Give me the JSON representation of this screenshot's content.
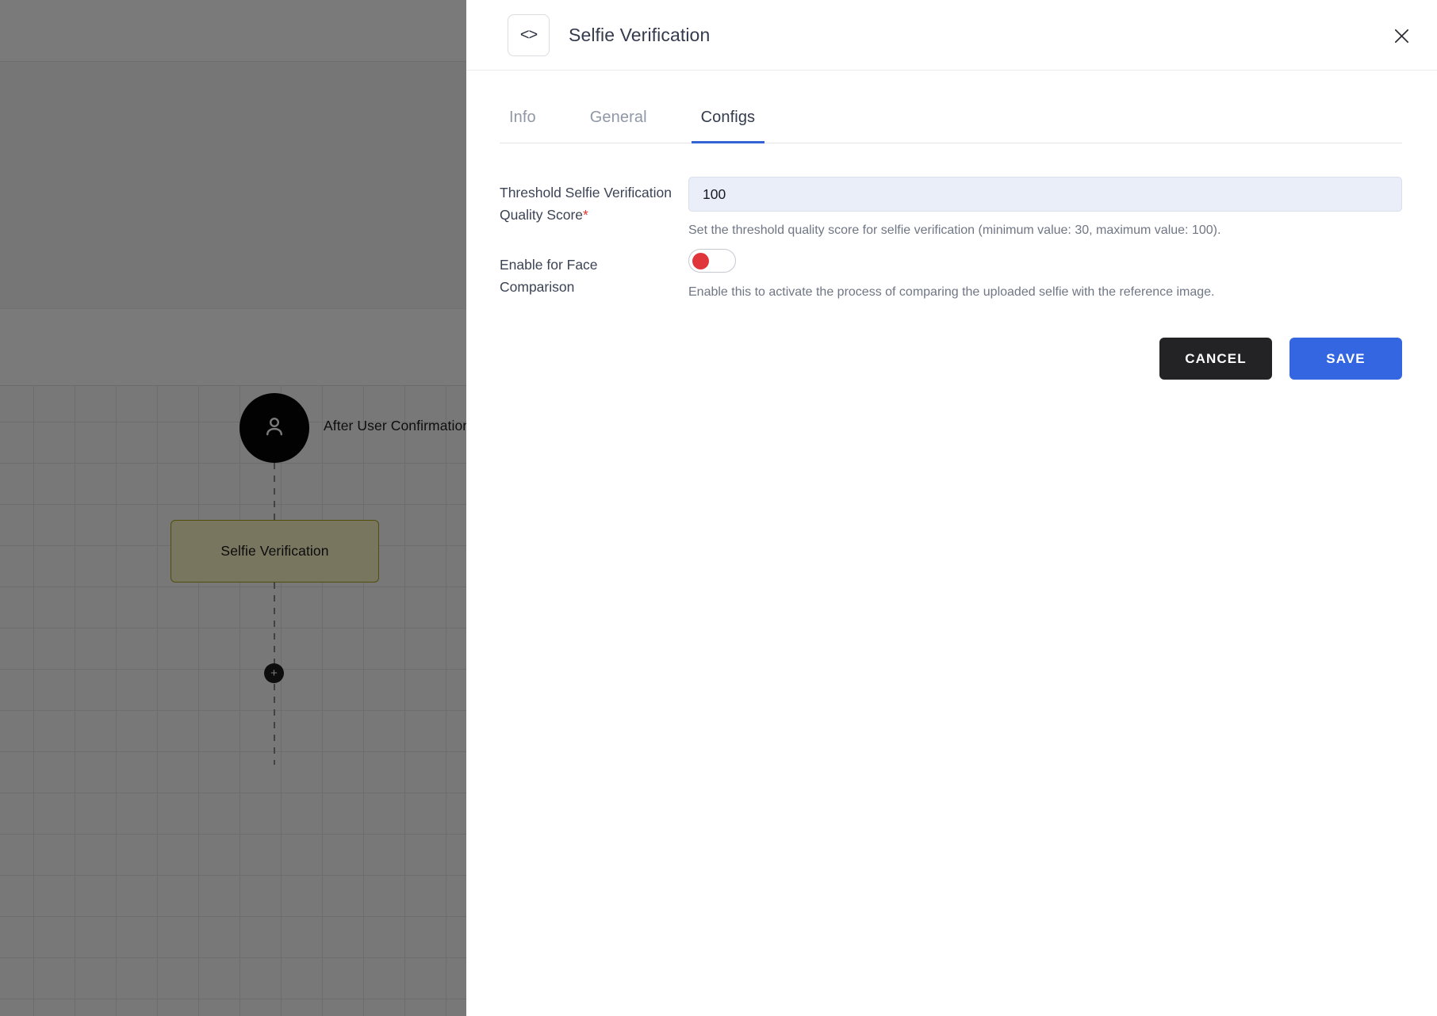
{
  "background": {
    "flow": {
      "start_node_icon": "user-icon",
      "start_label": "After User Confirmation",
      "node_label": "Selfie Verification",
      "add_button_label": "+"
    }
  },
  "panel": {
    "header": {
      "icon": "code-brackets-icon",
      "icon_glyph": "<>",
      "title": "Selfie Verification",
      "close_icon": "close-icon"
    },
    "tabs": [
      {
        "label": "Info",
        "active": false
      },
      {
        "label": "General",
        "active": false
      },
      {
        "label": "Configs",
        "active": true
      }
    ],
    "fields": [
      {
        "label": "Threshold Selfie Verification Quality Score",
        "required_marker": "*",
        "value": "100",
        "placeholder": "",
        "help": "Set the threshold quality score for selfie verification (minimum value: 30, maximum value: 100)."
      },
      {
        "label": "Enable for Face Comparison",
        "toggle_state": "off",
        "help": "Enable this to activate the process of comparing the uploaded selfie with the reference image."
      }
    ],
    "buttons": {
      "cancel": "CANCEL",
      "save": "SAVE"
    }
  },
  "colors": {
    "accent_blue": "#3366e0",
    "tab_underline": "#3463d6",
    "required_red": "#e0332c",
    "toggle_knob_red": "#e0353a",
    "cancel_dark": "#232326",
    "input_fill": "#e9eef9",
    "node_fill": "#fbf6c6",
    "node_border": "#a9a313"
  }
}
